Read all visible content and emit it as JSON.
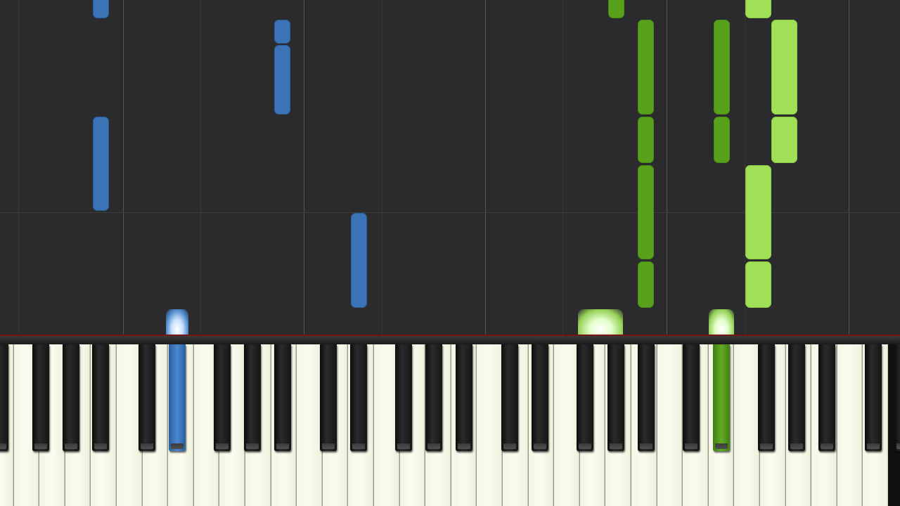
{
  "app": "piano-roll-visualizer",
  "colors": {
    "background": "#2b2b2d",
    "left_hand": "#3a73b6",
    "right_hand_dark": "#57a11b",
    "right_hand_light": "#9fe056",
    "rail_accent": "#7a1414"
  },
  "keyboard": {
    "visible_white_keys": 35,
    "pressed_keys": [
      {
        "type": "black",
        "hand": "left",
        "color": "blue"
      },
      {
        "type": "white",
        "hand": "right",
        "color": "light-green"
      },
      {
        "type": "black",
        "hand": "right",
        "color": "dark-green"
      }
    ]
  },
  "notes": {
    "blue": 5,
    "dark_green": 8,
    "light_green": 5
  }
}
